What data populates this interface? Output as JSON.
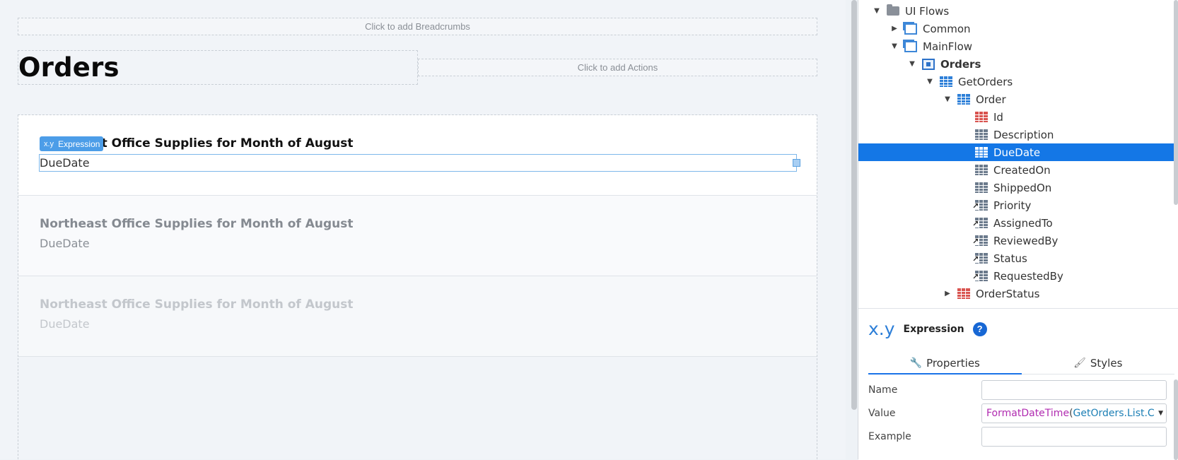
{
  "canvas": {
    "breadcrumbs_placeholder": "Click to add Breadcrumbs",
    "actions_placeholder": "Click to add Actions",
    "page_title": "Orders",
    "list_items": [
      {
        "title": "Northeast Office Supplies for Month of August",
        "subtitle": "DueDate"
      },
      {
        "title": "Northeast Office Supplies for Month of August",
        "subtitle": "DueDate"
      },
      {
        "title": "Northeast Office Supplies for Month of August",
        "subtitle": "DueDate"
      }
    ],
    "selection_tag": {
      "icon": "x.y",
      "label": "Expression"
    }
  },
  "tree": {
    "rows": [
      {
        "label": "UI Flows",
        "icon": "folder-icon",
        "expanded": true
      },
      {
        "label": "Common",
        "icon": "flow-icon",
        "expanded": false
      },
      {
        "label": "MainFlow",
        "icon": "flow-icon",
        "expanded": true
      },
      {
        "label": "Orders",
        "icon": "screen-icon",
        "expanded": true
      },
      {
        "label": "GetOrders",
        "icon": "aggregate-icon",
        "expanded": true
      },
      {
        "label": "Order",
        "icon": "entity-icon",
        "expanded": true
      },
      {
        "label": "Id",
        "icon": "attribute-key-icon"
      },
      {
        "label": "Description",
        "icon": "attribute-icon"
      },
      {
        "label": "DueDate",
        "icon": "attribute-icon",
        "selected": true
      },
      {
        "label": "CreatedOn",
        "icon": "attribute-icon"
      },
      {
        "label": "ShippedOn",
        "icon": "attribute-icon"
      },
      {
        "label": "Priority",
        "icon": "reference-attribute-icon"
      },
      {
        "label": "AssignedTo",
        "icon": "reference-attribute-icon"
      },
      {
        "label": "ReviewedBy",
        "icon": "reference-attribute-icon"
      },
      {
        "label": "Status",
        "icon": "reference-attribute-icon"
      },
      {
        "label": "RequestedBy",
        "icon": "reference-attribute-icon"
      },
      {
        "label": "OrderStatus",
        "icon": "static-entity-icon",
        "expanded": false
      }
    ]
  },
  "properties": {
    "icon": "x.y",
    "title": "Expression",
    "help": "?",
    "tabs": [
      {
        "label": "Properties",
        "icon": "wrench-icon"
      },
      {
        "label": "Styles",
        "icon": "brush-icon"
      }
    ],
    "fields": {
      "name_label": "Name",
      "name_value": "",
      "value_label": "Value",
      "value_fn": "FormatDateTime",
      "value_open": "(",
      "value_arg": "GetOrders.List.C",
      "example_label": "Example",
      "example_value": ""
    }
  },
  "colors": {
    "selection_blue": "#1477e6",
    "tag_blue": "#4c9de8",
    "function_purple": "#b02ab0",
    "argument_teal": "#1c7fb5"
  }
}
